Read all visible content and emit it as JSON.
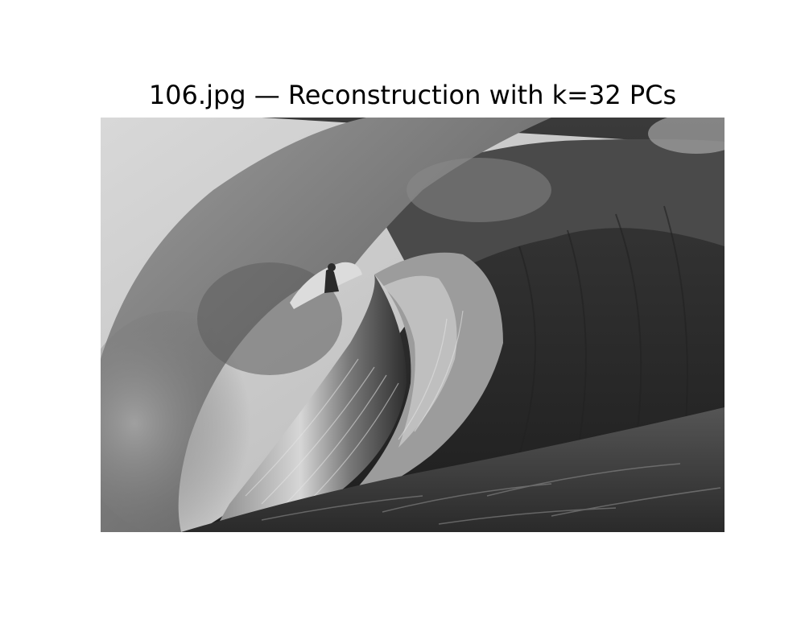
{
  "figure": {
    "title": "106.jpg — Reconstruction with k=32 PCs"
  },
  "image": {
    "subject": "grayscale photo of a large barreling ocean wave with a surfer inside the tube",
    "colormap": "gray"
  }
}
